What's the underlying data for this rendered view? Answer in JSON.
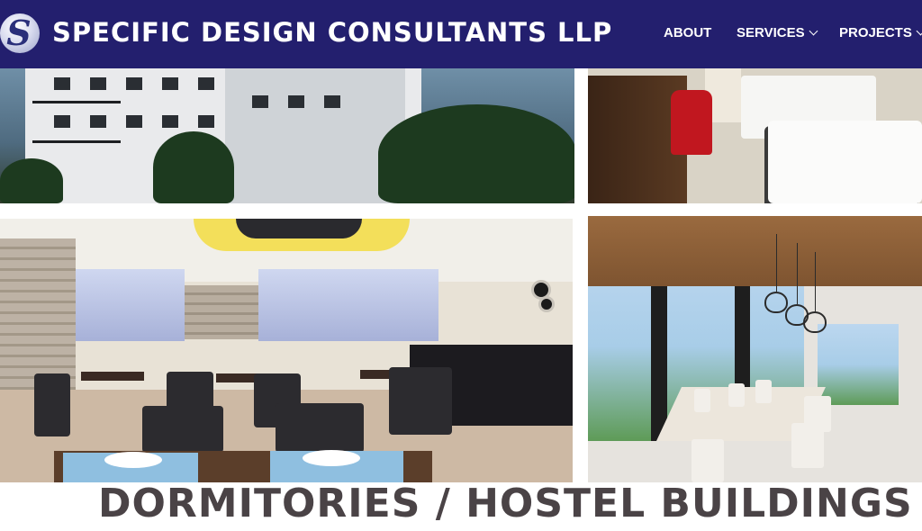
{
  "header": {
    "logo_glyph": "S",
    "brand": "SPECIFIC DESIGN CONSULTANTS LLP",
    "nav": [
      {
        "label": "ABOUT",
        "has_dropdown": false
      },
      {
        "label": "SERVICES",
        "has_dropdown": true
      },
      {
        "label": "PROJECTS",
        "has_dropdown": true
      }
    ],
    "bg_color": "#231f6e"
  },
  "gallery": [
    {
      "subject": "apartment-building-exterior"
    },
    {
      "subject": "hotel-room-interior"
    },
    {
      "subject": "restaurant-buffet-interior"
    },
    {
      "subject": "dining-pavilion-interior"
    }
  ],
  "main": {
    "heading": "DORMITORIES / HOSTEL BUILDINGS",
    "heading_color": "#4a4346"
  },
  "icons": [
    "chevron-down-icon",
    "logo-icon"
  ]
}
